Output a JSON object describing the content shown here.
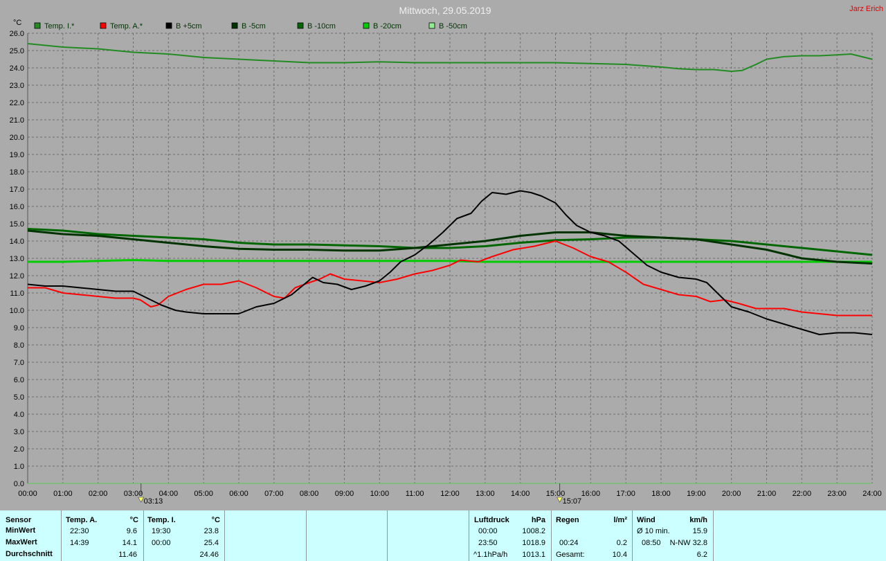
{
  "title": "Mittwoch, 29.05.2019",
  "author": "Jarz Erich",
  "y_unit": "°C",
  "colors": {
    "background": "#ababab",
    "grid": "#6e6e6e",
    "stats_bg": "#ccffff"
  },
  "chart_data": {
    "type": "line",
    "title": "Mittwoch, 29.05.2019",
    "ylabel": "°C",
    "ylim": [
      0,
      26
    ],
    "xlim": [
      0,
      24
    ],
    "grid": true,
    "legend_position": "top-left",
    "y_ticks": [
      "0.0",
      "1.0",
      "2.0",
      "3.0",
      "4.0",
      "5.0",
      "6.0",
      "7.0",
      "8.0",
      "9.0",
      "10.0",
      "11.0",
      "12.0",
      "13.0",
      "14.0",
      "15.0",
      "16.0",
      "17.0",
      "18.0",
      "19.0",
      "20.0",
      "21.0",
      "22.0",
      "23.0",
      "24.0",
      "25.0",
      "26.0"
    ],
    "x_ticks": [
      "00:00",
      "01:00",
      "02:00",
      "03:00",
      "04:00",
      "05:00",
      "06:00",
      "07:00",
      "08:00",
      "09:00",
      "10:00",
      "11:00",
      "12:00",
      "13:00",
      "14:00",
      "15:00",
      "16:00",
      "17:00",
      "18:00",
      "19:00",
      "20:00",
      "21:00",
      "22:00",
      "23:00",
      "24:00"
    ],
    "markers": [
      {
        "label": "03:13",
        "x": 3.22
      },
      {
        "label": "15:07",
        "x": 15.12
      }
    ],
    "series": [
      {
        "name": "Temp. I.*",
        "color": "#228b22",
        "width": 2,
        "points": [
          [
            0,
            25.4
          ],
          [
            1,
            25.2
          ],
          [
            2,
            25.1
          ],
          [
            3,
            24.9
          ],
          [
            4,
            24.8
          ],
          [
            5,
            24.6
          ],
          [
            6,
            24.5
          ],
          [
            7,
            24.4
          ],
          [
            8,
            24.3
          ],
          [
            9,
            24.3
          ],
          [
            10,
            24.35
          ],
          [
            11,
            24.3
          ],
          [
            12,
            24.3
          ],
          [
            13,
            24.3
          ],
          [
            14,
            24.3
          ],
          [
            15,
            24.3
          ],
          [
            16,
            24.25
          ],
          [
            17,
            24.2
          ],
          [
            18,
            24.05
          ],
          [
            18.5,
            23.95
          ],
          [
            19,
            23.9
          ],
          [
            19.5,
            23.9
          ],
          [
            20,
            23.8
          ],
          [
            20.3,
            23.85
          ],
          [
            20.7,
            24.2
          ],
          [
            21,
            24.5
          ],
          [
            21.5,
            24.65
          ],
          [
            22,
            24.7
          ],
          [
            22.5,
            24.7
          ],
          [
            23,
            24.75
          ],
          [
            23.4,
            24.8
          ],
          [
            23.8,
            24.6
          ],
          [
            24,
            24.5
          ]
        ]
      },
      {
        "name": "Temp. A.*",
        "color": "#ff0000",
        "width": 2,
        "points": [
          [
            0,
            11.3
          ],
          [
            0.5,
            11.3
          ],
          [
            1,
            11.0
          ],
          [
            1.5,
            10.9
          ],
          [
            2,
            10.8
          ],
          [
            2.5,
            10.7
          ],
          [
            3,
            10.7
          ],
          [
            3.2,
            10.6
          ],
          [
            3.5,
            10.2
          ],
          [
            3.7,
            10.3
          ],
          [
            4,
            10.8
          ],
          [
            4.5,
            11.2
          ],
          [
            5,
            11.5
          ],
          [
            5.5,
            11.5
          ],
          [
            6,
            11.7
          ],
          [
            6.5,
            11.3
          ],
          [
            7,
            10.8
          ],
          [
            7.3,
            10.7
          ],
          [
            7.6,
            11.3
          ],
          [
            8,
            11.6
          ],
          [
            8.3,
            11.8
          ],
          [
            8.6,
            12.1
          ],
          [
            9,
            11.8
          ],
          [
            9.5,
            11.7
          ],
          [
            10,
            11.6
          ],
          [
            10.5,
            11.8
          ],
          [
            11,
            12.1
          ],
          [
            11.5,
            12.3
          ],
          [
            12,
            12.6
          ],
          [
            12.3,
            12.9
          ],
          [
            12.8,
            12.8
          ],
          [
            13.2,
            13.1
          ],
          [
            13.8,
            13.5
          ],
          [
            14.4,
            13.7
          ],
          [
            15,
            14.0
          ],
          [
            15.5,
            13.6
          ],
          [
            16,
            13.1
          ],
          [
            16.5,
            12.8
          ],
          [
            17,
            12.2
          ],
          [
            17.5,
            11.5
          ],
          [
            18,
            11.2
          ],
          [
            18.5,
            10.9
          ],
          [
            19,
            10.8
          ],
          [
            19.4,
            10.5
          ],
          [
            19.8,
            10.6
          ],
          [
            20.2,
            10.4
          ],
          [
            20.7,
            10.1
          ],
          [
            21,
            10.1
          ],
          [
            21.5,
            10.1
          ],
          [
            22,
            9.9
          ],
          [
            22.5,
            9.8
          ],
          [
            23,
            9.7
          ],
          [
            23.5,
            9.7
          ],
          [
            24,
            9.7
          ]
        ]
      },
      {
        "name": "B +5cm",
        "color": "#000000",
        "width": 2,
        "points": [
          [
            0,
            11.5
          ],
          [
            0.5,
            11.4
          ],
          [
            1,
            11.4
          ],
          [
            1.5,
            11.3
          ],
          [
            2,
            11.2
          ],
          [
            2.5,
            11.1
          ],
          [
            3,
            11.1
          ],
          [
            3.5,
            10.6
          ],
          [
            3.8,
            10.3
          ],
          [
            4.2,
            10.0
          ],
          [
            4.5,
            9.9
          ],
          [
            5,
            9.8
          ],
          [
            5.5,
            9.8
          ],
          [
            6,
            9.8
          ],
          [
            6.5,
            10.2
          ],
          [
            7,
            10.4
          ],
          [
            7.5,
            10.9
          ],
          [
            7.8,
            11.4
          ],
          [
            8.1,
            11.9
          ],
          [
            8.4,
            11.6
          ],
          [
            8.8,
            11.5
          ],
          [
            9.2,
            11.2
          ],
          [
            9.6,
            11.4
          ],
          [
            10,
            11.7
          ],
          [
            10.3,
            12.2
          ],
          [
            10.6,
            12.8
          ],
          [
            11,
            13.2
          ],
          [
            11.4,
            13.8
          ],
          [
            11.8,
            14.5
          ],
          [
            12.2,
            15.3
          ],
          [
            12.6,
            15.6
          ],
          [
            12.9,
            16.3
          ],
          [
            13.2,
            16.8
          ],
          [
            13.6,
            16.7
          ],
          [
            14,
            16.9
          ],
          [
            14.3,
            16.8
          ],
          [
            14.6,
            16.6
          ],
          [
            15,
            16.2
          ],
          [
            15.3,
            15.5
          ],
          [
            15.6,
            14.9
          ],
          [
            16,
            14.5
          ],
          [
            16.4,
            14.3
          ],
          [
            16.8,
            14.0
          ],
          [
            17.2,
            13.3
          ],
          [
            17.6,
            12.6
          ],
          [
            18,
            12.2
          ],
          [
            18.5,
            11.9
          ],
          [
            19,
            11.8
          ],
          [
            19.3,
            11.6
          ],
          [
            19.6,
            11.0
          ],
          [
            20,
            10.2
          ],
          [
            20.5,
            9.9
          ],
          [
            21,
            9.5
          ],
          [
            21.5,
            9.2
          ],
          [
            22,
            8.9
          ],
          [
            22.5,
            8.6
          ],
          [
            23,
            8.7
          ],
          [
            23.5,
            8.7
          ],
          [
            24,
            8.6
          ]
        ]
      },
      {
        "name": "B -5cm",
        "color": "#003300",
        "width": 3,
        "points": [
          [
            0,
            14.6
          ],
          [
            1,
            14.4
          ],
          [
            2,
            14.3
          ],
          [
            3,
            14.1
          ],
          [
            4,
            13.9
          ],
          [
            5,
            13.7
          ],
          [
            6,
            13.55
          ],
          [
            7,
            13.5
          ],
          [
            8,
            13.5
          ],
          [
            9,
            13.45
          ],
          [
            10,
            13.45
          ],
          [
            11,
            13.6
          ],
          [
            12,
            13.8
          ],
          [
            13,
            14.0
          ],
          [
            14,
            14.3
          ],
          [
            15,
            14.5
          ],
          [
            16,
            14.5
          ],
          [
            17,
            14.3
          ],
          [
            18,
            14.2
          ],
          [
            19,
            14.1
          ],
          [
            20,
            13.8
          ],
          [
            21,
            13.5
          ],
          [
            22,
            13.0
          ],
          [
            23,
            12.8
          ],
          [
            24,
            12.7
          ]
        ]
      },
      {
        "name": "B -10cm",
        "color": "#006600",
        "width": 3,
        "points": [
          [
            0,
            14.7
          ],
          [
            1,
            14.6
          ],
          [
            2,
            14.4
          ],
          [
            3,
            14.3
          ],
          [
            4,
            14.2
          ],
          [
            5,
            14.1
          ],
          [
            6,
            13.9
          ],
          [
            7,
            13.8
          ],
          [
            8,
            13.8
          ],
          [
            9,
            13.75
          ],
          [
            10,
            13.7
          ],
          [
            11,
            13.6
          ],
          [
            12,
            13.6
          ],
          [
            13,
            13.7
          ],
          [
            14,
            13.9
          ],
          [
            15,
            14.05
          ],
          [
            16,
            14.1
          ],
          [
            17,
            14.2
          ],
          [
            18,
            14.2
          ],
          [
            19,
            14.1
          ],
          [
            20,
            14.0
          ],
          [
            21,
            13.8
          ],
          [
            22,
            13.6
          ],
          [
            23,
            13.4
          ],
          [
            24,
            13.2
          ]
        ]
      },
      {
        "name": "B -20cm",
        "color": "#00cc00",
        "width": 3,
        "points": [
          [
            0,
            12.8
          ],
          [
            1,
            12.8
          ],
          [
            2,
            12.85
          ],
          [
            3,
            12.9
          ],
          [
            4,
            12.85
          ],
          [
            5,
            12.85
          ],
          [
            6,
            12.85
          ],
          [
            7,
            12.85
          ],
          [
            8,
            12.85
          ],
          [
            9,
            12.85
          ],
          [
            10,
            12.85
          ],
          [
            11,
            12.85
          ],
          [
            12,
            12.85
          ],
          [
            13,
            12.8
          ],
          [
            14,
            12.8
          ],
          [
            15,
            12.8
          ],
          [
            16,
            12.8
          ],
          [
            17,
            12.8
          ],
          [
            18,
            12.8
          ],
          [
            19,
            12.8
          ],
          [
            20,
            12.8
          ],
          [
            21,
            12.8
          ],
          [
            22,
            12.8
          ],
          [
            23,
            12.8
          ],
          [
            24,
            12.8
          ]
        ]
      },
      {
        "name": "B -50cm",
        "color": "#90ee90",
        "width": 2,
        "points": []
      }
    ]
  },
  "stats": {
    "sensor_header": "Sensor",
    "row_min": "MinWert",
    "row_max": "MaxWert",
    "row_avg": "Durchschnitt",
    "temp_a": {
      "header": "Temp. A.",
      "unit": "°C",
      "min_time": "22:30",
      "min_val": "9.6",
      "max_time": "14:39",
      "max_val": "14.1",
      "avg": "11.46"
    },
    "temp_i": {
      "header": "Temp. I.",
      "unit": "°C",
      "min_time": "19:30",
      "min_val": "23.8",
      "max_time": "00:00",
      "max_val": "25.4",
      "avg": "24.46"
    },
    "luftdruck": {
      "header": "Luftdruck",
      "unit": "hPa",
      "r1_time": "00:00",
      "r1_val": "1008.2",
      "r2_time": "23:50",
      "r2_val": "1018.9",
      "r3_label": "^1.1hPa/h",
      "r3_val": "1013.1"
    },
    "regen": {
      "header": "Regen",
      "unit": "l/m²",
      "r2_time": "00:24",
      "r2_val": "0.2",
      "r3_label": "Gesamt:",
      "r3_val": "10.4"
    },
    "wind": {
      "header": "Wind",
      "unit": "km/h",
      "r1_label": "Ø 10 min.",
      "r1_val": "15.9",
      "r2_time": "08:50",
      "r2_val": "N-NW 32.8",
      "r3_val": "6.2"
    }
  }
}
